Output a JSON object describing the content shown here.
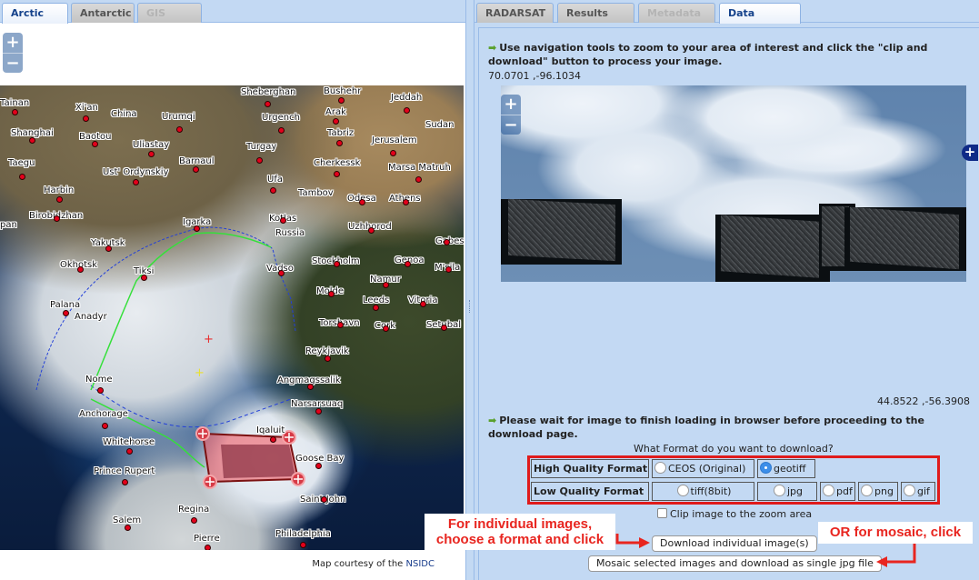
{
  "left_panel": {
    "tabs": [
      {
        "label": "Arctic",
        "state": "active"
      },
      {
        "label": "Antarctic",
        "state": "normal"
      },
      {
        "label": "GIS",
        "state": "disabled"
      }
    ],
    "zoom_in": "+",
    "zoom_out": "−",
    "courtesy_prefix": "Map courtesy of the",
    "courtesy_link": "NSIDC",
    "map_labels": [
      "Tainan",
      "Xi'an",
      "China",
      "Urumqi",
      "Shanghai",
      "Baotou",
      "Uliastay",
      "Barnaul",
      "Taegu",
      "Ust' Ordynskiy",
      "Harbin",
      "Sheberghan",
      "Bushehr",
      "Jeddah",
      "Arak",
      "Urgench",
      "Sudan",
      "Tabriz",
      "Turgay",
      "Jerusalem",
      "Cherkessk",
      "Marsa Matruh",
      "Ufa",
      "Tambov",
      "Odesa",
      "Athens",
      "Birobidzhan",
      "pan",
      "Igarka",
      "Kotlas",
      "Uzhhorod",
      "Yakutsk",
      "Russia",
      "Gabes",
      "Okhotsk",
      "Tiksi",
      "Vadso",
      "Stockholm",
      "Genoa",
      "M'sila",
      "Namur",
      "Palana",
      "Molde",
      "Leeds",
      "Vitoria",
      "Anadyr",
      "Torshavn",
      "Cork",
      "Setubal",
      "Reykjavik",
      "Nome",
      "Angmagssalik",
      "Narsarsuaq",
      "Anchorage",
      "Iqaluit",
      "Whitehorse",
      "Goose Bay",
      "Prince Rupert",
      "Saint John",
      "Regina",
      "Salem",
      "Pierre",
      "Philadelphia"
    ]
  },
  "right_panel": {
    "tabs": [
      {
        "label": "RADARSAT",
        "state": "normal"
      },
      {
        "label": "Results",
        "state": "normal"
      },
      {
        "label": "Metadata",
        "state": "disabled"
      },
      {
        "label": "Data",
        "state": "active"
      }
    ],
    "instruction_1": "Use navigation tools to zoom to your area of interest and click the \"clip and download\" button to process your image.",
    "coord_top_left": "70.0701 ,-96.1034",
    "coord_bottom_right": "44.8522 ,-56.3908",
    "thumb_zoom_in": "+",
    "thumb_zoom_out": "−",
    "expand_icon": "+",
    "instruction_2": "Please wait for image to finish loading in browser before proceeding to the download page.",
    "format_question": "What Format do you want to download?",
    "high_quality": {
      "label": "High Quality Format",
      "options": [
        {
          "label": "CEOS (Original)",
          "selected": false
        },
        {
          "label": "geotiff",
          "selected": true
        }
      ]
    },
    "low_quality": {
      "label": "Low Quality Format",
      "options": [
        {
          "label": "tiff(8bit)",
          "selected": false
        },
        {
          "label": "jpg",
          "selected": false
        },
        {
          "label": "pdf",
          "selected": false
        },
        {
          "label": "png",
          "selected": false
        },
        {
          "label": "gif",
          "selected": false
        }
      ]
    },
    "clip_label": "Clip image to the zoom area",
    "clip_checked": false,
    "download_button": "Download individual image(s)",
    "mosaic_button": "Mosaic selected images and download as single jpg file"
  },
  "annotations": {
    "individual": "For individual images, choose a format and click",
    "individual_line1": "For individual images,",
    "individual_line2": "choose a format and click",
    "mosaic": "OR for mosaic, click",
    "color": "#e8251f"
  }
}
